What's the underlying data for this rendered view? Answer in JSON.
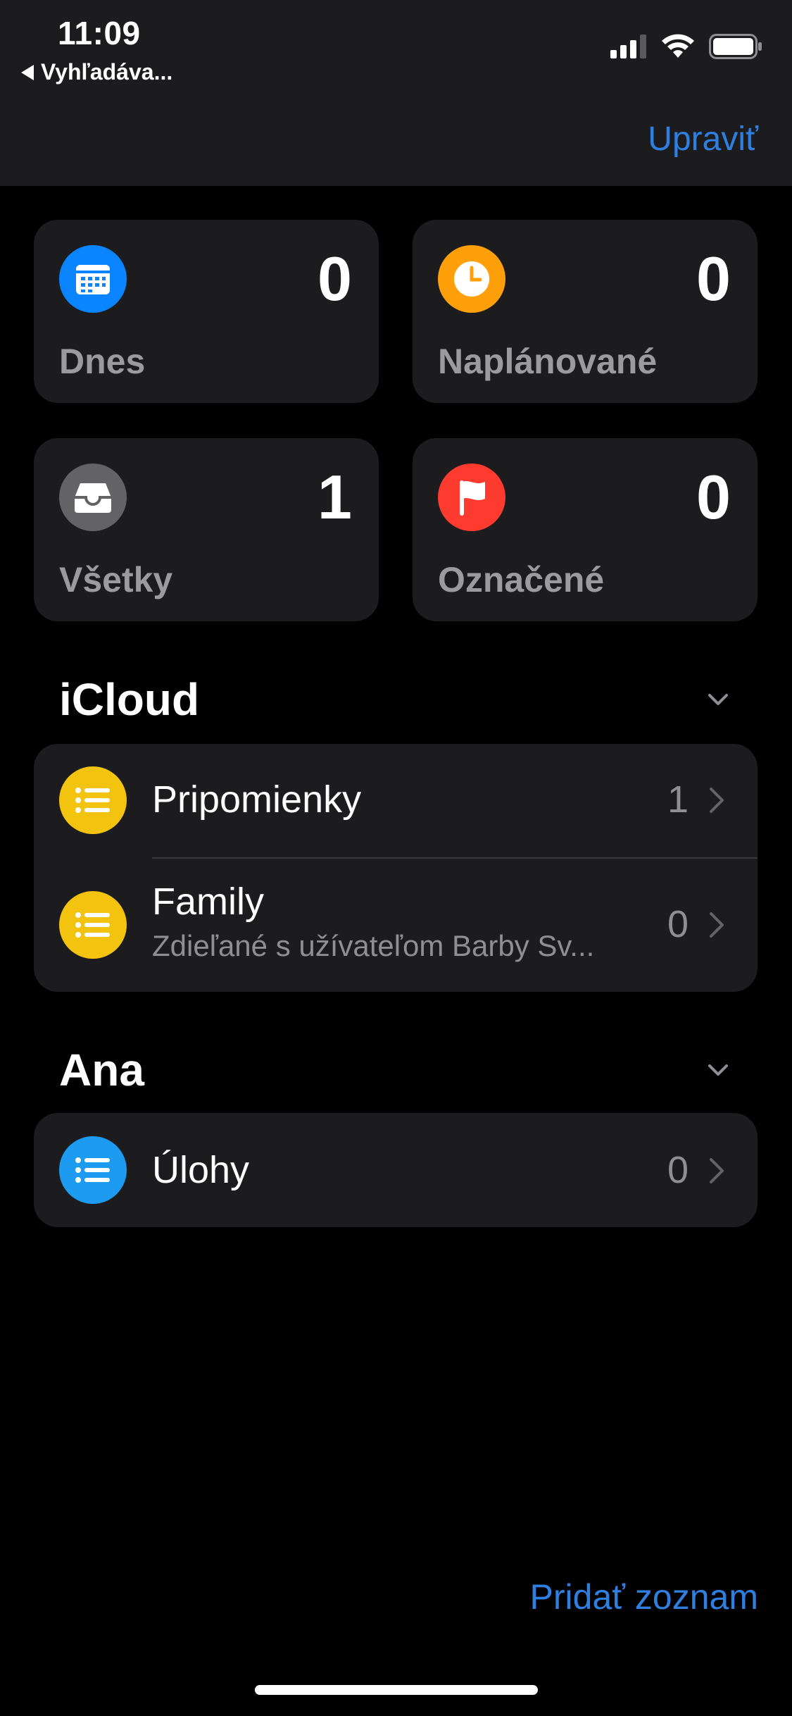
{
  "status": {
    "time": "11:09",
    "back_label": "Vyhľadáva..."
  },
  "header": {
    "edit_label": "Upraviť"
  },
  "smart_lists": [
    {
      "label": "Dnes",
      "count": "0",
      "icon": "calendar-icon",
      "color": "#0a84ff"
    },
    {
      "label": "Naplánované",
      "count": "0",
      "icon": "clock-icon",
      "color": "#ff9f0a"
    },
    {
      "label": "Všetky",
      "count": "1",
      "icon": "tray-icon",
      "color": "#636366"
    },
    {
      "label": "Označené",
      "count": "0",
      "icon": "flag-icon",
      "color": "#ff3b30"
    }
  ],
  "sections": [
    {
      "title": "iCloud",
      "lists": [
        {
          "title": "Pripomienky",
          "subtitle": "",
          "count": "1",
          "color": "#f2c40f",
          "icon": "list-icon"
        },
        {
          "title": "Family",
          "subtitle": "Zdieľané s užívateľom Barby Sv...",
          "count": "0",
          "color": "#f2c40f",
          "icon": "list-icon"
        }
      ]
    },
    {
      "title": "Ana",
      "lists": [
        {
          "title": "Úlohy",
          "subtitle": "",
          "count": "0",
          "color": "#1c9bf0",
          "icon": "list-icon"
        }
      ]
    }
  ],
  "footer": {
    "add_list_label": "Pridať zoznam"
  }
}
